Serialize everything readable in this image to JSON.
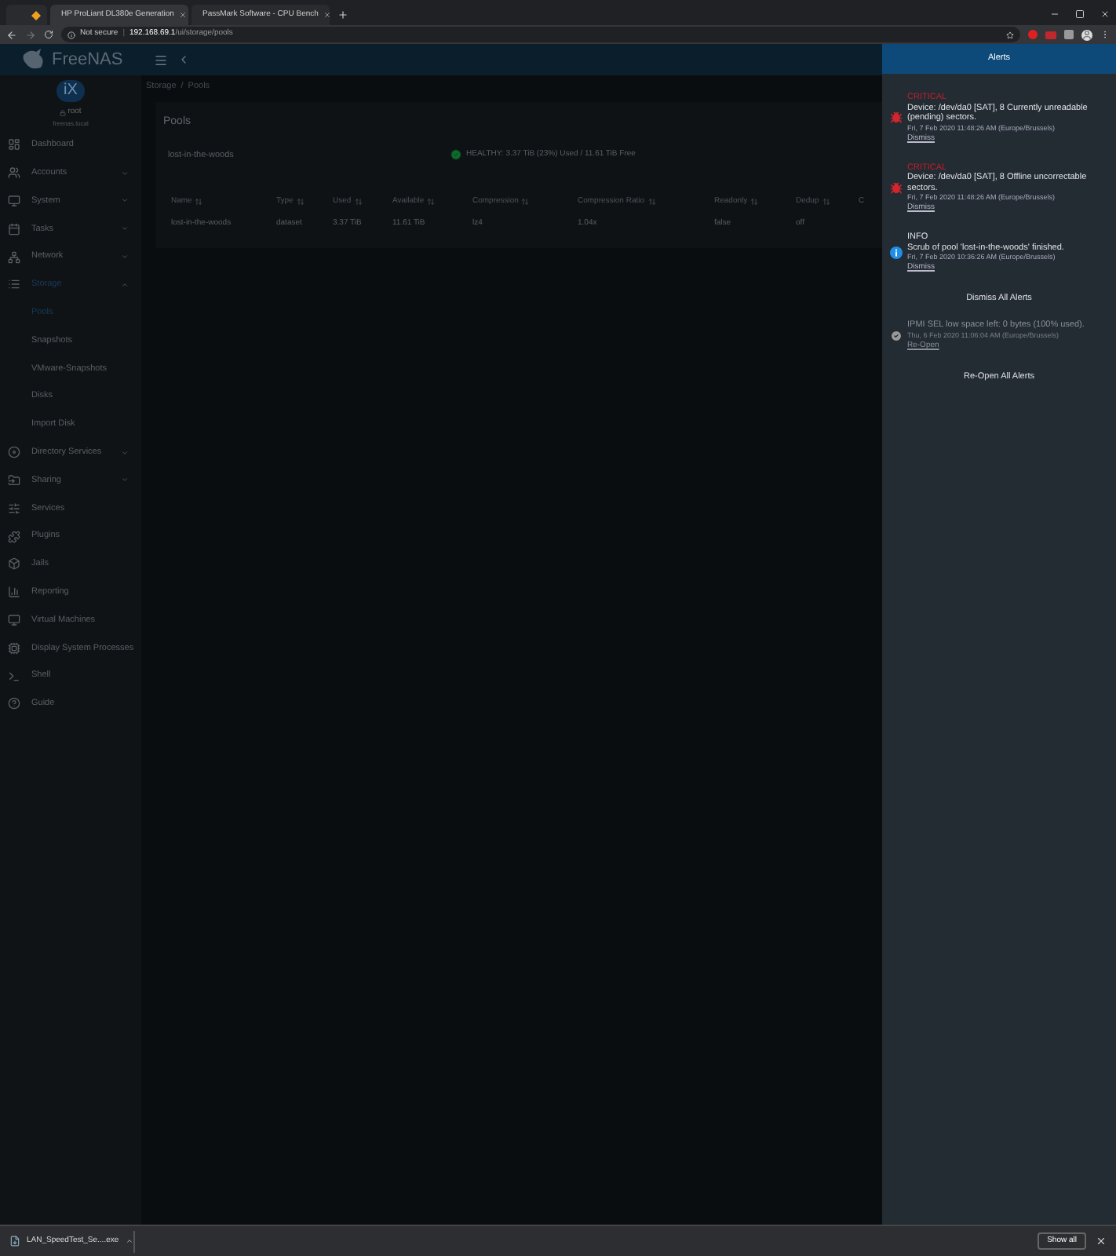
{
  "browser": {
    "tabs": [
      {
        "selected": false
      },
      {
        "title": "HP ProLiant DL380e Generation",
        "selected": true
      },
      {
        "title": "PassMark Software - CPU Bench",
        "selected": false
      }
    ],
    "security": "Not secure",
    "separator": "|",
    "url_host": "192.168.69.1",
    "url_path": "/ui/storage/pools"
  },
  "app": {
    "logo": "FreeNAS",
    "breadcrumb": [
      "Storage",
      "Pools"
    ],
    "breadcrumb_separator": "/"
  },
  "user": {
    "logo": "iX",
    "name": "root",
    "host": "freenas.local"
  },
  "sidebar": {
    "items": [
      {
        "label": "Dashboard",
        "selected": false
      },
      {
        "label": "Accounts",
        "expanded": false,
        "selected": false
      },
      {
        "label": "System",
        "expanded": false,
        "selected": false
      },
      {
        "label": "Tasks",
        "expanded": false,
        "selected": false
      },
      {
        "label": "Network",
        "expanded": false,
        "selected": false
      },
      {
        "label": "Storage",
        "expanded": true,
        "selected": true,
        "children": [
          {
            "label": "Pools",
            "selected": true
          },
          {
            "label": "Snapshots",
            "selected": false
          },
          {
            "label": "VMware-Snapshots",
            "selected": false
          },
          {
            "label": "Disks",
            "selected": false
          },
          {
            "label": "Import Disk",
            "selected": false
          }
        ]
      },
      {
        "label": "Directory Services",
        "expanded": false,
        "selected": false
      },
      {
        "label": "Sharing",
        "expanded": false,
        "selected": false
      },
      {
        "label": "Services",
        "selected": false
      },
      {
        "label": "Plugins",
        "selected": false
      },
      {
        "label": "Jails",
        "selected": false
      },
      {
        "label": "Reporting",
        "selected": false
      },
      {
        "label": "Virtual Machines",
        "selected": false
      },
      {
        "label": "Display System Processes",
        "selected": false
      },
      {
        "label": "Shell",
        "selected": false
      },
      {
        "label": "Guide",
        "selected": false
      }
    ]
  },
  "pools": {
    "title": "Pools",
    "pool_name": "lost-in-the-woods",
    "status": "HEALTHY: 3.37 TiB (23%) Used / 11.61 TiB Free",
    "table": {
      "columns": [
        "Name",
        "Type",
        "Used",
        "Available",
        "Compression",
        "Compression Ratio",
        "Readonly",
        "Dedup"
      ],
      "column_9": "C",
      "rows": [
        [
          "lost-in-the-woods",
          "dataset",
          "3.37 TiB",
          "11.61 TiB",
          "lz4",
          "1.04x",
          "false",
          "off"
        ]
      ]
    }
  },
  "alerts": {
    "title": "Alerts",
    "items": [
      {
        "kind": "critical",
        "level": "CRITICAL",
        "message": "Device: /dev/da0 [SAT], 8 Currently unreadable (pending) sectors.",
        "time": "Fri, 7 Feb 2020 11:48:26 AM (Europe/Brussels)",
        "action": "Dismiss"
      },
      {
        "kind": "critical",
        "level": "CRITICAL",
        "message": "Device: /dev/da0 [SAT], 8 Offline uncorrectable sectors.",
        "time": "Fri, 7 Feb 2020 11:48:26 AM (Europe/Brussels)",
        "action": "Dismiss"
      },
      {
        "kind": "info",
        "level": "INFO",
        "message": "Scrub of pool 'lost-in-the-woods' finished.",
        "time": "Fri, 7 Feb 2020 10:36:26 AM (Europe/Brussels)",
        "action": "Dismiss"
      }
    ],
    "dismiss_all": "Dismiss All Alerts",
    "dismissed": [
      {
        "message": "IPMI SEL low space left: 0 bytes (100% used).",
        "time": "Thu, 6 Feb 2020 11:06:04 AM (Europe/Brussels)",
        "action": "Re-Open"
      }
    ],
    "reopen_all": "Re-Open All Alerts"
  },
  "downloads": {
    "file": "LAN_SpeedTest_Se....exe",
    "show_all": "Show all"
  }
}
